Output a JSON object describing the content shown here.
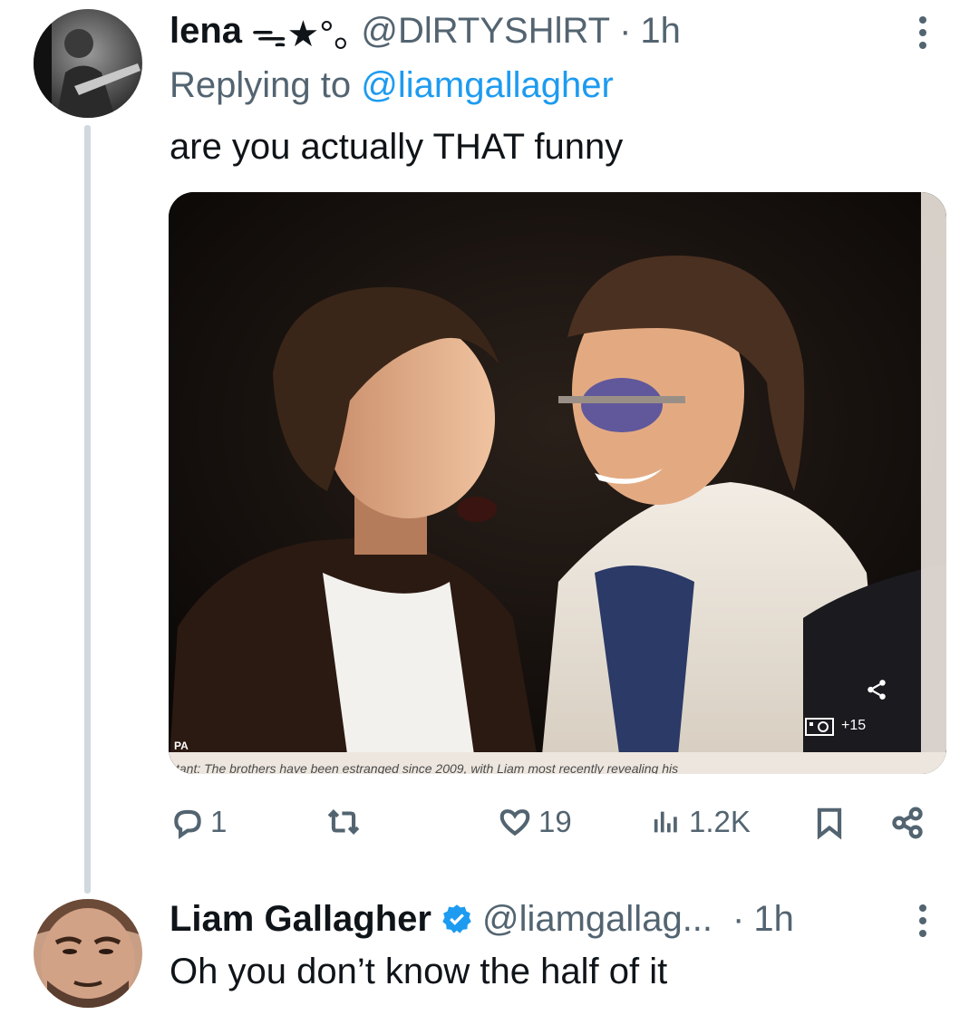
{
  "reply_tweet": {
    "display_name": "lena",
    "name_decoration": "ᯓ★°｡",
    "handle": "@DlRTYSHlRT",
    "separator": "·",
    "time": "1h",
    "replying_prefix": "Replying to",
    "replying_to": "@liamgallagher",
    "text": "are you actually THAT funny",
    "media": {
      "photo_credit": "PA",
      "gallery_count": "+15",
      "caption_line": "tant: The brothers have been estranged since 2009, with Liam most recently revealing his"
    },
    "actions": {
      "replies": "1",
      "retweets": "",
      "likes": "19",
      "views": "1.2K"
    }
  },
  "main_tweet": {
    "display_name": "Liam Gallagher",
    "handle": "@liamgallag...",
    "separator": "·",
    "time": "1h",
    "text": "Oh you don’t know the half of it"
  },
  "icons": [
    "more-icon",
    "reply-icon",
    "retweet-icon",
    "like-icon",
    "views-icon",
    "bookmark-icon",
    "share-icon",
    "verified-badge-icon",
    "camera-icon"
  ],
  "colors": {
    "accent": "#1d9bf0",
    "muted": "#536471",
    "thread_line": "#cfd9de"
  }
}
